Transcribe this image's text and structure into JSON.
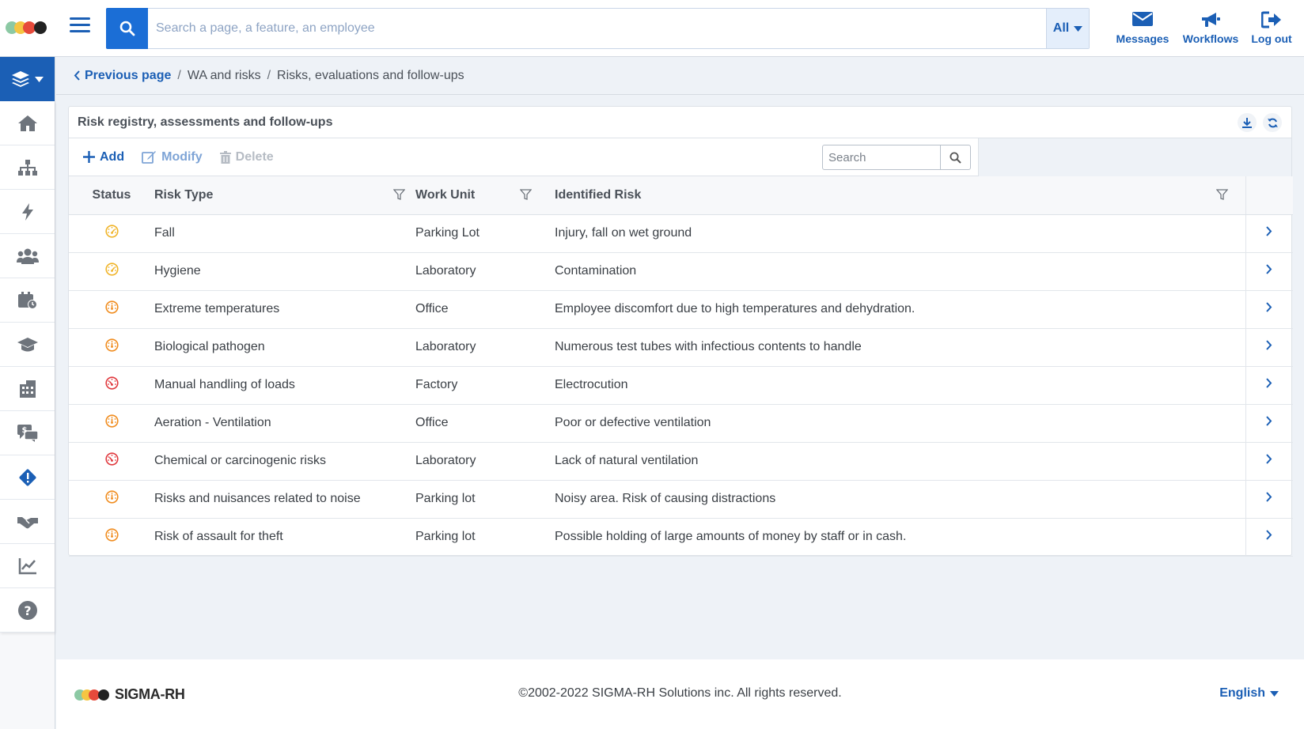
{
  "header": {
    "search_placeholder": "Search a page, a feature, an employee",
    "scope_label": "All",
    "actions": [
      {
        "label": "Messages",
        "icon": "envelope-icon"
      },
      {
        "label": "Workflows",
        "icon": "megaphone-icon"
      },
      {
        "label": "Log out",
        "icon": "logout-icon"
      }
    ]
  },
  "sidebar": {
    "items": [
      {
        "icon": "home-icon"
      },
      {
        "icon": "org-chart-icon"
      },
      {
        "icon": "lightning-icon"
      },
      {
        "icon": "users-icon"
      },
      {
        "icon": "calendar-clock-icon"
      },
      {
        "icon": "graduation-cap-icon"
      },
      {
        "icon": "building-icon"
      },
      {
        "icon": "pay-chat-icon"
      },
      {
        "icon": "warning-diamond-icon"
      },
      {
        "icon": "handshake-icon"
      },
      {
        "icon": "chart-icon"
      },
      {
        "icon": "help-icon"
      }
    ]
  },
  "breadcrumb": {
    "previous": "Previous page",
    "items": [
      "WA and risks",
      "Risks, evaluations and follow-ups"
    ]
  },
  "panel": {
    "title": "Risk registry, assessments and follow-ups",
    "toolbar": {
      "add": "Add",
      "modify": "Modify",
      "delete": "Delete"
    },
    "search_placeholder": "Search",
    "columns": {
      "status": "Status",
      "risk_type": "Risk Type",
      "work_unit": "Work Unit",
      "identified_risk": "Identified Risk"
    },
    "rows": [
      {
        "status": "low",
        "risk_type": "Fall",
        "work_unit": "Parking Lot",
        "identified_risk": "Injury, fall on wet ground"
      },
      {
        "status": "low",
        "risk_type": "Hygiene",
        "work_unit": "Laboratory",
        "identified_risk": "Contamination"
      },
      {
        "status": "medium",
        "risk_type": "Extreme temperatures",
        "work_unit": "Office",
        "identified_risk": "Employee discomfort due to high temperatures and dehydration."
      },
      {
        "status": "medium",
        "risk_type": "Biological pathogen",
        "work_unit": "Laboratory",
        "identified_risk": "Numerous test tubes with infectious contents to handle"
      },
      {
        "status": "high",
        "risk_type": "Manual handling of loads",
        "work_unit": "Factory",
        "identified_risk": "Electrocution"
      },
      {
        "status": "medium",
        "risk_type": "Aeration - Ventilation",
        "work_unit": "Office",
        "identified_risk": "Poor or defective ventilation"
      },
      {
        "status": "high",
        "risk_type": "Chemical or carcinogenic risks",
        "work_unit": "Laboratory",
        "identified_risk": "Lack of natural ventilation"
      },
      {
        "status": "medium",
        "risk_type": "Risks and nuisances related to noise",
        "work_unit": "Parking lot",
        "identified_risk": "Noisy area. Risk of causing distractions"
      },
      {
        "status": "medium",
        "risk_type": "Risk of assault for theft",
        "work_unit": "Parking lot",
        "identified_risk": "Possible holding of large amounts of money by staff or in cash."
      }
    ]
  },
  "status_colors": {
    "low": "#f0b429",
    "medium": "#f08c1e",
    "high": "#e0393e"
  },
  "colors": {
    "accent": "#1b5fb5",
    "search_button": "#1b6ed6"
  },
  "footer": {
    "brand": "SIGMA-RH",
    "copyright": "©2002-2022 SIGMA-RH Solutions inc. All rights reserved.",
    "language": "English"
  }
}
